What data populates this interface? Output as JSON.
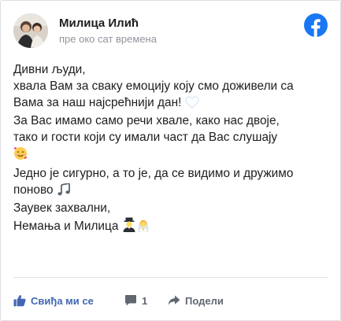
{
  "post": {
    "author": "Милица Илић",
    "time": "пре око сат времена",
    "lines": [
      "Дивни људи,",
      "хвала Вам за сваку емоцију коју смо доживели са",
      "Вама за наш најсрећнији дан!",
      "За Вас имамо само речи хвале, како нас двоје,",
      "тако и гости који су имали част да Вас слушају",
      "",
      "Једно је сигурно, а то је, да се видимо и дружимо",
      "поново",
      "Заувек захвални,",
      "Немања и Милица"
    ]
  },
  "actions": {
    "like_label": "Свиђа ми се",
    "comment_count": "1",
    "share_label": "Подели"
  },
  "colors": {
    "brand": "#1877f2",
    "like": "#4267b2",
    "text": "#1c1e21",
    "muted": "#90949c"
  },
  "icons": [
    "facebook-logo-icon",
    "heart-emoji-icon",
    "smiling-face-with-hearts-emoji-icon",
    "musical-notes-emoji-icon",
    "groom-emoji-icon",
    "bride-emoji-icon",
    "thumbs-up-icon",
    "comment-icon",
    "share-icon"
  ]
}
